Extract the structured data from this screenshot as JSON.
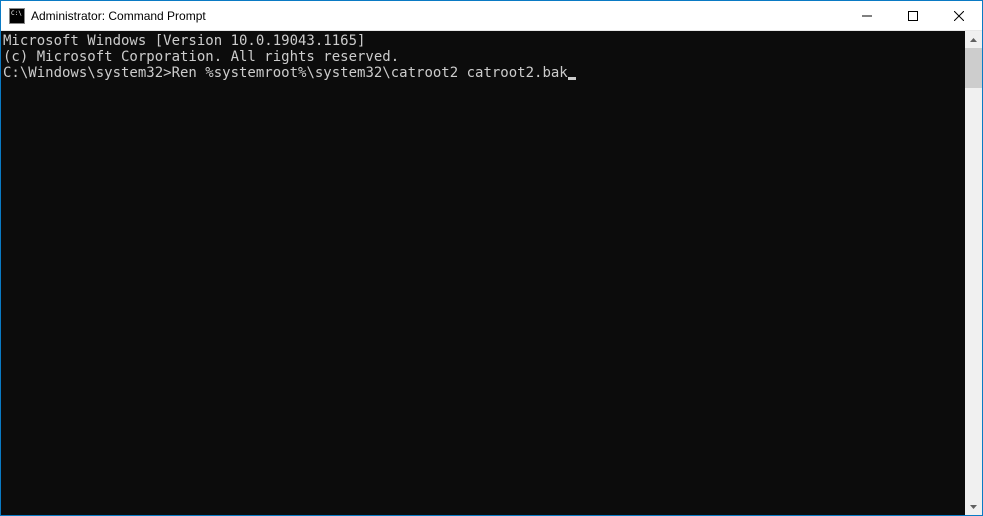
{
  "window": {
    "title": "Administrator: Command Prompt"
  },
  "console": {
    "line1": "Microsoft Windows [Version 10.0.19043.1165]",
    "line2": "(c) Microsoft Corporation. All rights reserved.",
    "blank": "",
    "prompt": "C:\\Windows\\system32>",
    "command": "Ren %systemroot%\\system32\\catroot2 catroot2.bak"
  }
}
